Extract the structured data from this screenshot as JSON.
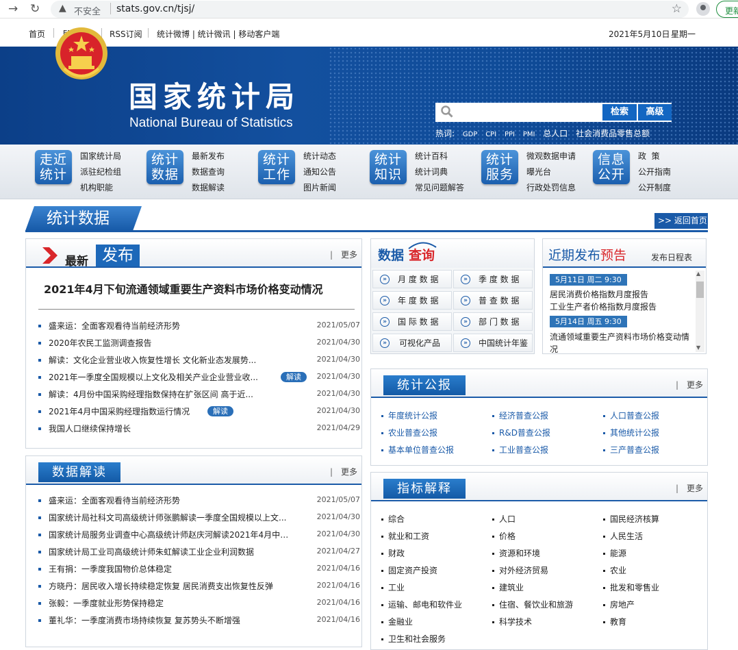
{
  "browser": {
    "insecure_label": "不安全",
    "url": "stats.gov.cn/tjsj/",
    "update_label": "更新"
  },
  "toplinks": {
    "home": "首页",
    "english": "ENGLISH",
    "rss": "RSS订阅",
    "mobile": "统计微博 | 统计微讯 | 移动客户端",
    "date": "2021年5月10日",
    "weekday": "星期一"
  },
  "banner": {
    "title_cn": "国家统计局",
    "title_en": "National Bureau of Statistics",
    "search_placeholder": "",
    "search_button": "检索",
    "advanced_button": "高级",
    "hot_label": "热词:",
    "hot_words": [
      "GDP",
      "CPI",
      "PPI",
      "PMI",
      "总人口",
      "社会消费品零售总额"
    ]
  },
  "mainnav": [
    {
      "badge": [
        "走近",
        "统计"
      ],
      "links": [
        "国家统计局",
        "派驻纪检组",
        "机构职能"
      ]
    },
    {
      "badge": [
        "统计",
        "数据"
      ],
      "links": [
        "最新发布",
        "数据查询",
        "数据解读"
      ]
    },
    {
      "badge": [
        "统计",
        "工作"
      ],
      "links": [
        "统计动态",
        "通知公告",
        "图片新闻"
      ]
    },
    {
      "badge": [
        "统计",
        "知识"
      ],
      "links": [
        "统计百科",
        "统计词典",
        "常见问题解答"
      ]
    },
    {
      "badge": [
        "统计",
        "服务"
      ],
      "links": [
        "微观数据申请",
        "曝光台",
        "行政处罚信息"
      ]
    },
    {
      "badge": [
        "信息",
        "公开"
      ],
      "links": [
        "政  策",
        "公开指南",
        "公开制度"
      ]
    }
  ],
  "section": {
    "title": "统计数据",
    "back_home": ">> 返回首页"
  },
  "latest": {
    "title_a": "最新",
    "title_b": "发布",
    "more": "更多",
    "headline": "2021年4月下旬流通领域重要生产资料市场价格变动情况",
    "items": [
      {
        "title": "盛来运：全面客观看待当前经济形势",
        "date": "2021/05/07",
        "tag": ""
      },
      {
        "title": "2020年农民工监测调查报告",
        "date": "2021/04/30",
        "tag": ""
      },
      {
        "title": "解读：文化企业营业收入恢复性增长 文化新业态发展势...",
        "date": "2021/04/30",
        "tag": ""
      },
      {
        "title": "2021年一季度全国规模以上文化及相关产业企业营业收...",
        "date": "2021/04/30",
        "tag": "解读"
      },
      {
        "title": "解读：4月份中国采购经理指数保持在扩张区间 高于近...",
        "date": "2021/04/30",
        "tag": ""
      },
      {
        "title": "2021年4月中国采购经理指数运行情况",
        "date": "2021/04/30",
        "tag": "解读"
      },
      {
        "title": "我国人口继续保持增长",
        "date": "2021/04/29",
        "tag": ""
      }
    ]
  },
  "interpretation": {
    "title": "数据解读",
    "more": "更多",
    "items": [
      {
        "title": "盛来运：全面客观看待当前经济形势",
        "date": "2021/05/07"
      },
      {
        "title": "国家统计局社科文司高级统计师张鹏解读一季度全国规模以上文...",
        "date": "2021/04/30"
      },
      {
        "title": "国家统计局服务业调查中心高级统计师赵庆河解读2021年4月中国...",
        "date": "2021/04/30"
      },
      {
        "title": "国家统计局工业司高级统计师朱虹解读工业企业利润数据",
        "date": "2021/04/27"
      },
      {
        "title": "王有捐：一季度我国物价总体稳定",
        "date": "2021/04/16"
      },
      {
        "title": "方晓丹：居民收入增长持续稳定恢复 居民消费支出恢复性反弹",
        "date": "2021/04/16"
      },
      {
        "title": "张毅：一季度就业形势保持稳定",
        "date": "2021/04/16"
      },
      {
        "title": "董礼华：一季度消费市场持续恢复 复苏势头不断增强",
        "date": "2021/04/16"
      }
    ]
  },
  "query": {
    "title_a": "数据",
    "title_b": "查询",
    "buttons": [
      "月 度 数 据",
      "季 度 数 据",
      "年 度 数 据",
      "普 查 数 据",
      "国 际 数 据",
      "部 门 数 据",
      "可视化产品",
      "中国统计年鉴"
    ]
  },
  "schedule": {
    "title_a": "近期发布",
    "title_b": "预告",
    "calendar": "发布日程表",
    "entries": [
      {
        "date": "5月11日  周二  9:30",
        "items": [
          "居民消费价格指数月度报告",
          "工业生产者价格指数月度报告"
        ]
      },
      {
        "date": "5月14日  周五  9:30",
        "items": [
          "流通领域重要生产资料市场价格变动情况"
        ]
      }
    ]
  },
  "bulletin": {
    "title": "统计公报",
    "more": "更多",
    "items": [
      "年度统计公报",
      "经济普查公报",
      "人口普查公报",
      "农业普查公报",
      "R&D普查公报",
      "其他统计公报",
      "基本单位普查公报",
      "工业普查公报",
      "三产普查公报"
    ]
  },
  "indicators": {
    "title": "指标解释",
    "more": "更多",
    "items": [
      "综合",
      "人口",
      "国民经济核算",
      "就业和工资",
      "价格",
      "人民生活",
      "财政",
      "资源和环境",
      "能源",
      "固定资产投资",
      "对外经济贸易",
      "农业",
      "工业",
      "建筑业",
      "批发和零售业",
      "运输、邮电和软件业",
      "住宿、餐饮业和旅游",
      "房地产",
      "金融业",
      "科学技术",
      "教育",
      "卫生和社会服务"
    ]
  }
}
